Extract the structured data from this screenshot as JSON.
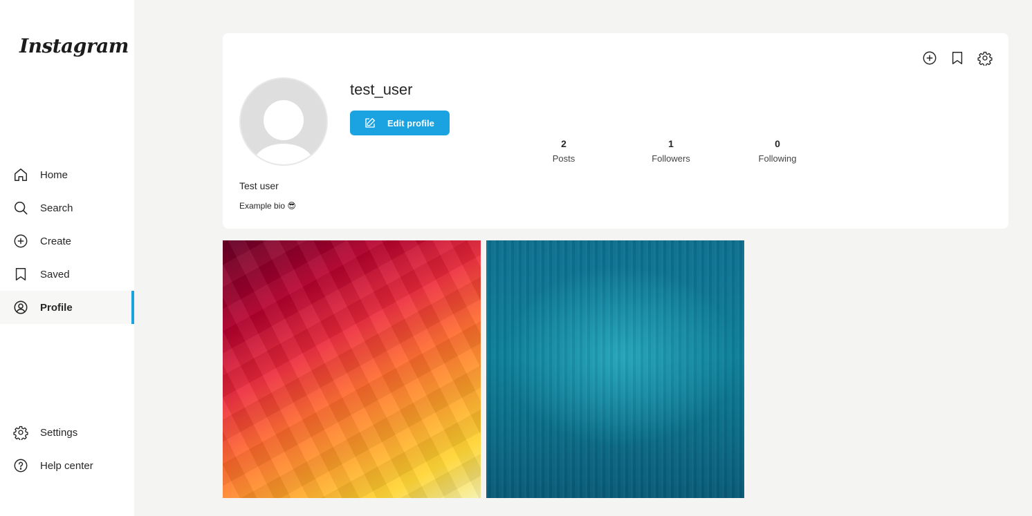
{
  "sidebar": {
    "logo": "Instagram",
    "items": [
      {
        "label": "Home",
        "icon": "home-icon"
      },
      {
        "label": "Search",
        "icon": "search-icon"
      },
      {
        "label": "Create",
        "icon": "plus-circle-icon"
      },
      {
        "label": "Saved",
        "icon": "bookmark-icon"
      },
      {
        "label": "Profile",
        "icon": "user-circle-icon",
        "active": true
      }
    ],
    "footer_items": [
      {
        "label": "Settings",
        "icon": "gear-icon"
      },
      {
        "label": "Help center",
        "icon": "help-circle-icon"
      }
    ]
  },
  "profile": {
    "username": "test_user",
    "edit_label": "Edit profile",
    "full_name": "Test user",
    "bio": "Example bio 😎",
    "stats": [
      {
        "value": "2",
        "label": "Posts"
      },
      {
        "value": "1",
        "label": "Followers"
      },
      {
        "value": "0",
        "label": "Following"
      }
    ],
    "actions": [
      "plus-circle-icon",
      "bookmark-icon",
      "gear-icon"
    ]
  },
  "posts": [
    {
      "kind": "red-orange-yellow polygon gradient"
    },
    {
      "kind": "teal streaked gradient"
    }
  ],
  "colors": {
    "accent": "#1aa3e0",
    "background": "#f4f4f3",
    "card": "#ffffff"
  }
}
